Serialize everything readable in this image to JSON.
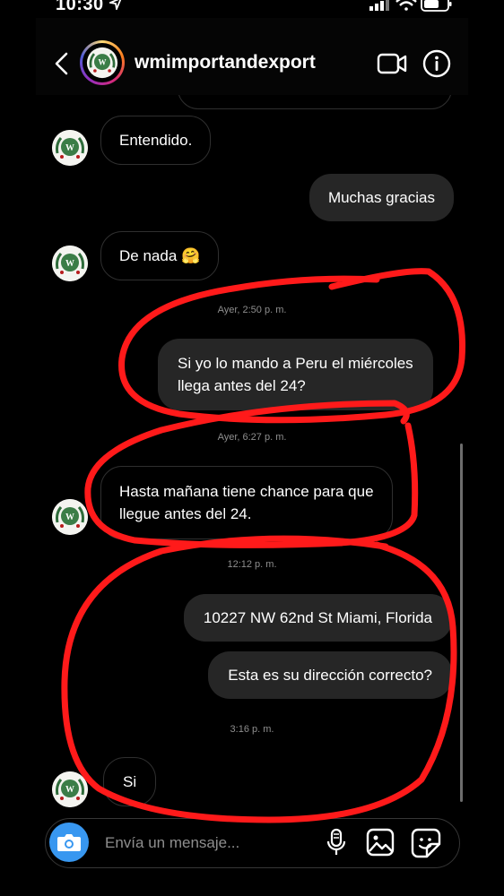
{
  "status": {
    "time": "10:30"
  },
  "header": {
    "username": "wmimportandexport"
  },
  "messages": {
    "m1": "Entendido.",
    "m2": "Muchas gracias",
    "m3": "De nada 🤗",
    "ts1": "Ayer, 2:50 p. m.",
    "m4_line1": "Si yo lo mando a Peru el miércoles",
    "m4_line2": "llega antes del 24?",
    "ts2": "Ayer, 6:27 p. m.",
    "m5_line1": "Hasta mañana tiene chance para que",
    "m5_line2": "llegue antes del 24.",
    "ts3": "12:12 p. m.",
    "m6": "10227 NW 62nd St Miami, Florida",
    "m7": "Esta es su dirección correcto?",
    "ts4": "3:16 p. m.",
    "m8": "Si"
  },
  "composer": {
    "placeholder": "Envía un mensaje..."
  },
  "colors": {
    "annotation": "#ff1a1a",
    "accent": "#3897f0",
    "bubble_out": "#262626"
  },
  "icons": [
    "back-chevron-icon",
    "video-call-icon",
    "info-icon",
    "camera-icon",
    "microphone-icon",
    "gallery-icon",
    "sticker-icon"
  ]
}
